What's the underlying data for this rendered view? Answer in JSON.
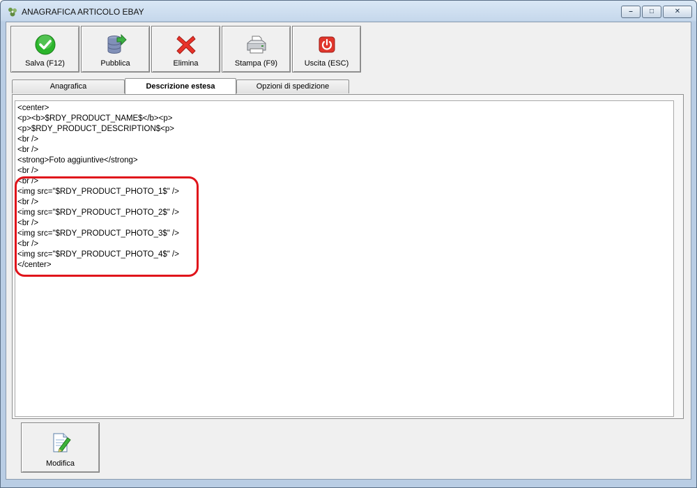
{
  "window": {
    "title": "ANAGRAFICA ARTICOLO EBAY",
    "minimize_glyph": "–",
    "maximize_glyph": "□",
    "close_glyph": "✕"
  },
  "toolbar": {
    "save_label": "Salva (F12)",
    "publish_label": "Pubblica",
    "delete_label": "Elimina",
    "print_label": "Stampa (F9)",
    "exit_label": "Uscita (ESC)"
  },
  "tabs": [
    {
      "label": "Anagrafica",
      "active": false
    },
    {
      "label": "Descrizione estesa",
      "active": true
    },
    {
      "label": "Opzioni di spedizione",
      "active": false
    }
  ],
  "editor": {
    "lines": [
      "<center>",
      "<p><b>$RDY_PRODUCT_NAME$</b><p>",
      "<p>$RDY_PRODUCT_DESCRIPTION$<p>",
      "<br />",
      "<br />",
      "<strong>Foto aggiuntive</strong>",
      "<br />",
      "<br />",
      "<img src=\"$RDY_PRODUCT_PHOTO_1$\" />",
      "<br />",
      "<img src=\"$RDY_PRODUCT_PHOTO_2$\" />",
      "<br />",
      "<img src=\"$RDY_PRODUCT_PHOTO_3$\" />",
      "<br />",
      "<img src=\"$RDY_PRODUCT_PHOTO_4$\" />",
      "</center>"
    ]
  },
  "footer": {
    "edit_label": "Modifica"
  },
  "colors": {
    "highlight": "#e0141b",
    "save_green": "#2bb52b",
    "delete_red": "#e8332a",
    "exit_red": "#e0362c"
  }
}
